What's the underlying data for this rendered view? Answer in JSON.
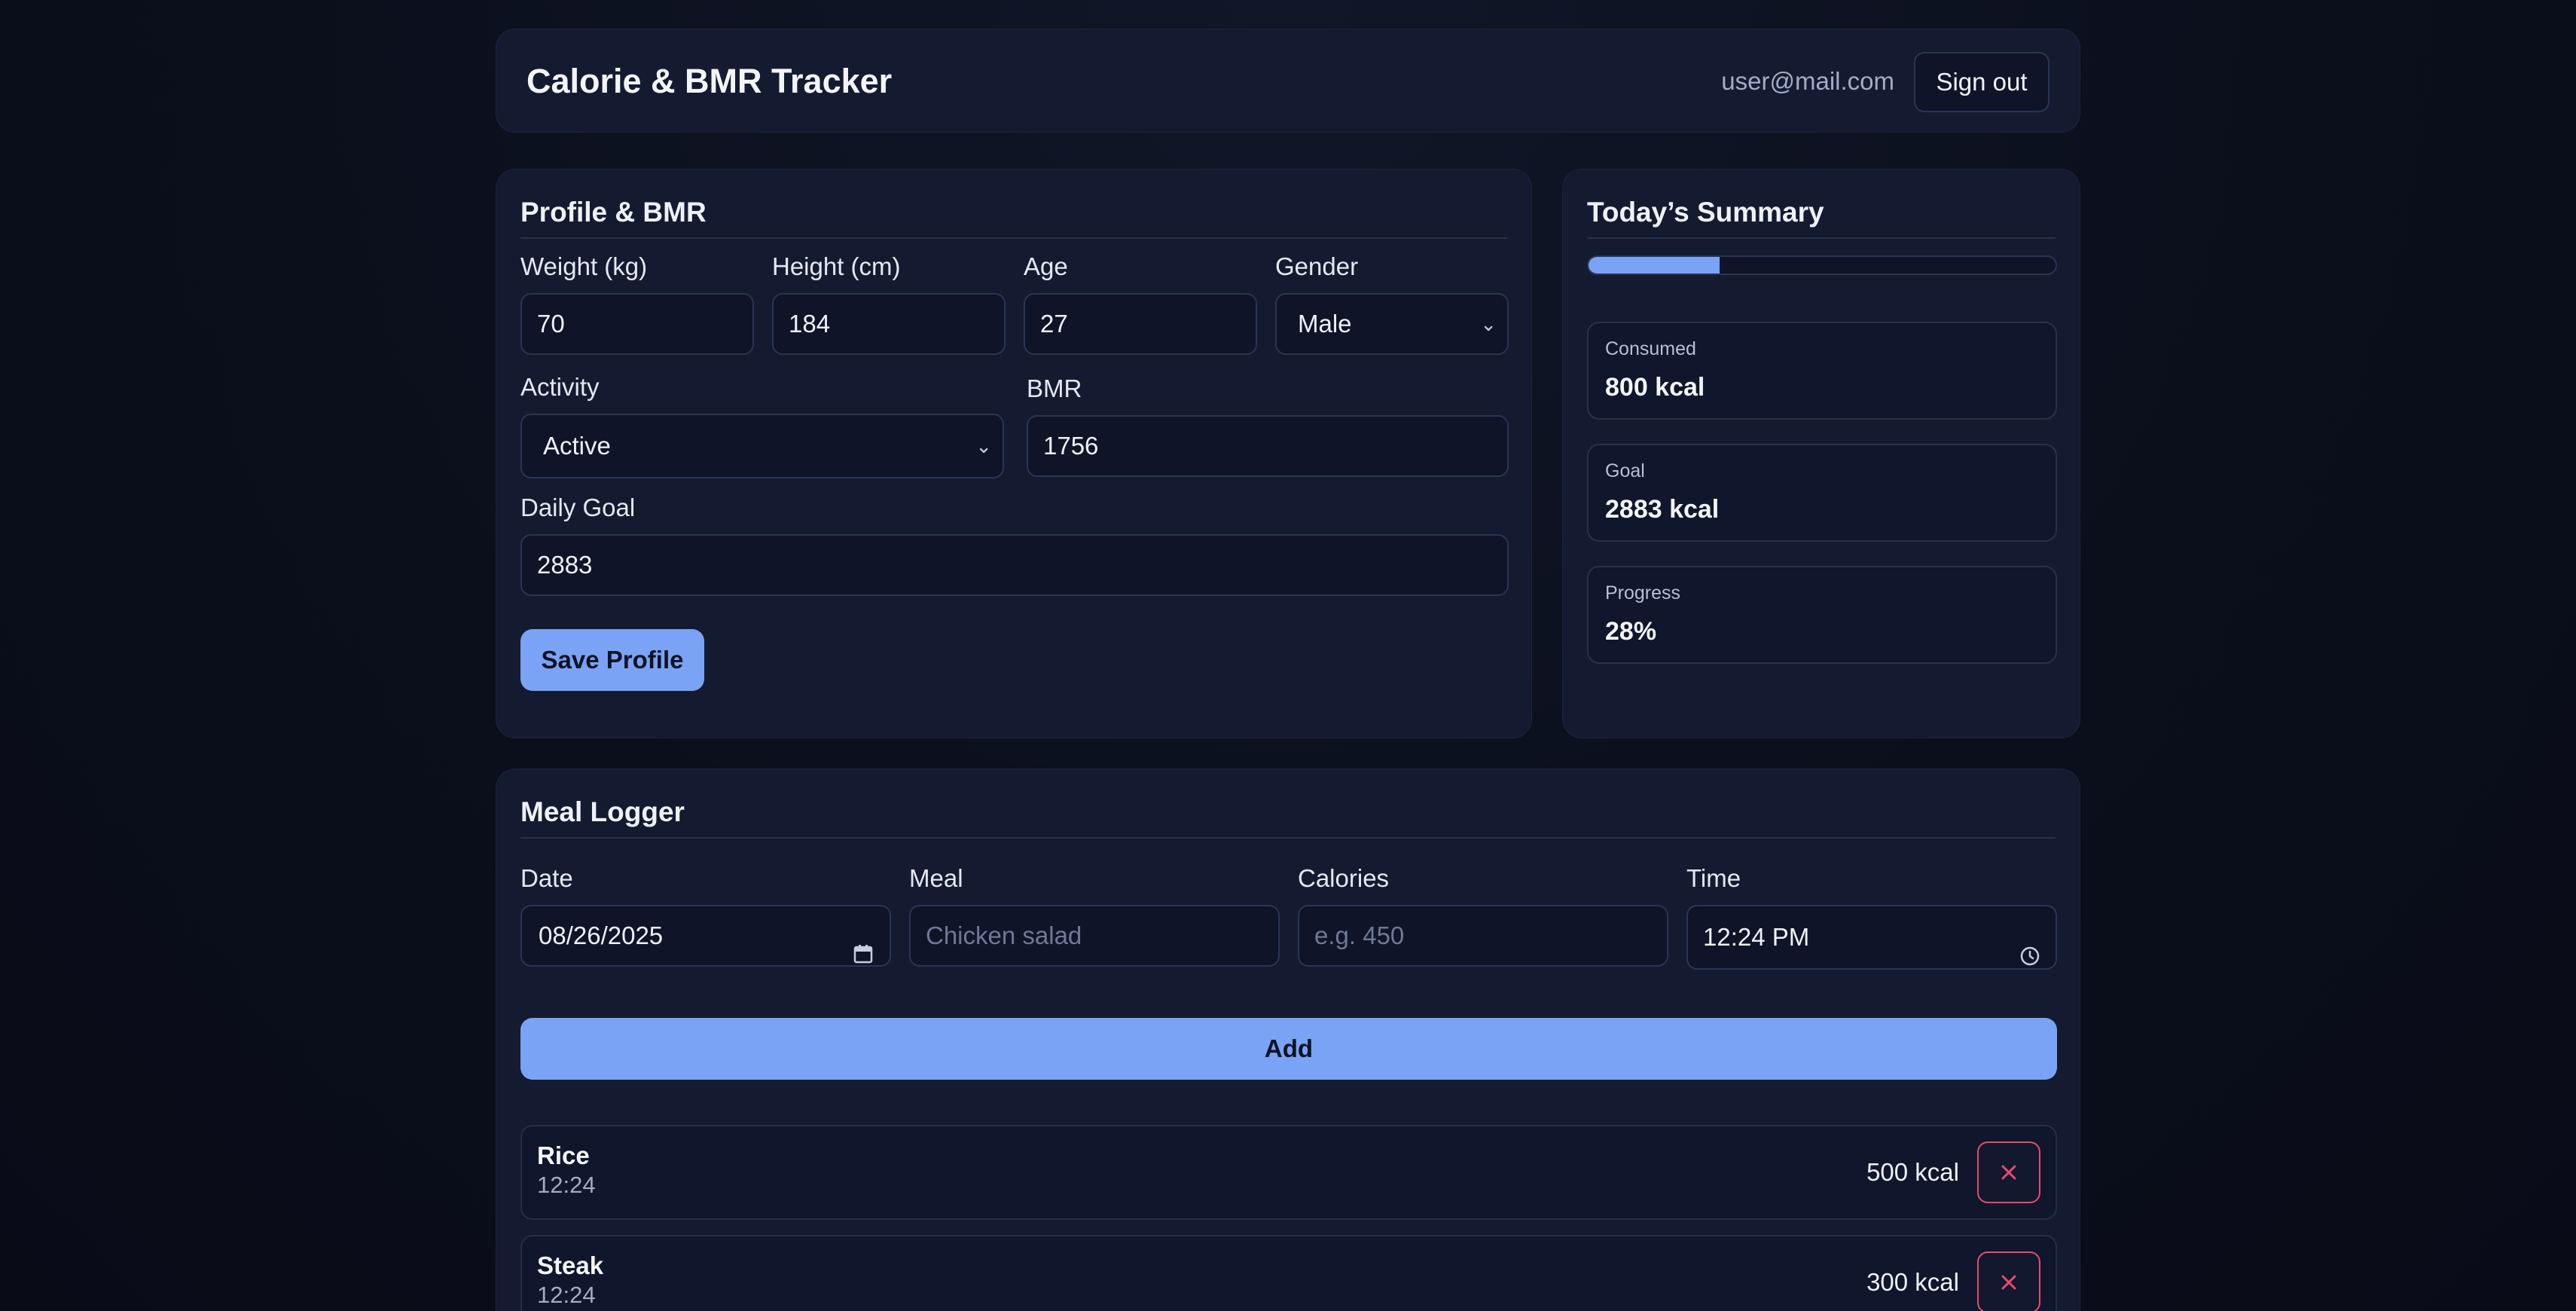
{
  "header": {
    "title": "Calorie & BMR Tracker",
    "user_email": "user@mail.com",
    "signout_label": "Sign out"
  },
  "profile": {
    "title": "Profile & BMR",
    "weight_label": "Weight (kg)",
    "weight_value": "70",
    "height_label": "Height (cm)",
    "height_value": "184",
    "age_label": "Age",
    "age_value": "27",
    "gender_label": "Gender",
    "gender_value": "Male",
    "activity_label": "Activity",
    "activity_value": "Active",
    "bmr_label": "BMR",
    "bmr_value": "1756",
    "goal_label": "Daily Goal",
    "goal_value": "2883",
    "save_label": "Save Profile"
  },
  "summary": {
    "title": "Today’s Summary",
    "progress_fraction": 0.28,
    "consumed_label": "Consumed",
    "consumed_value": "800 kcal",
    "goal_label": "Goal",
    "goal_value": "2883 kcal",
    "progress_label": "Progress",
    "progress_value": "28%"
  },
  "meal_logger": {
    "title": "Meal Logger",
    "date_label": "Date",
    "date_value": "08/26/2025",
    "meal_label": "Meal",
    "meal_placeholder": "Chicken salad",
    "calories_label": "Calories",
    "calories_placeholder": "e.g. 450",
    "time_label": "Time",
    "time_value": "12:24 PM",
    "add_label": "Add",
    "meals": [
      {
        "name": "Rice",
        "time": "12:24",
        "kcal": "500 kcal"
      },
      {
        "name": "Steak",
        "time": "12:24",
        "kcal": "300 kcal"
      }
    ]
  },
  "colors": {
    "accent": "#7ba3f5",
    "danger": "#e44c6e",
    "card": "#141b31",
    "background": "#0b0f1c"
  }
}
